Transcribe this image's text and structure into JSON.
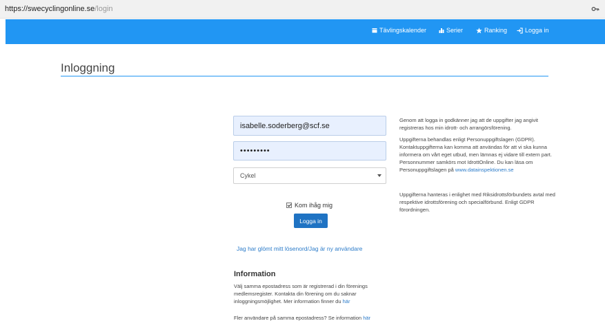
{
  "browser": {
    "url_scheme_host": "https://swecyclingonline.se",
    "url_path": "/login",
    "key_icon": "key-icon"
  },
  "nav": {
    "items": [
      {
        "label": "Tävlingskalender",
        "icon": "calendar-icon"
      },
      {
        "label": "Serier",
        "icon": "bar-chart-icon"
      },
      {
        "label": "Ranking",
        "icon": "star-icon"
      },
      {
        "label": "Logga in",
        "icon": "sign-in-icon"
      }
    ],
    "color": "#2196f3"
  },
  "page": {
    "title": "Inloggning"
  },
  "form": {
    "email_value": "isabelle.soderberg@scf.se",
    "password_value": "•••••••••",
    "sport_selected": "Cykel",
    "remember_label": "Kom ihåg mig",
    "remember_checked": true,
    "login_button": "Logga in",
    "forgot_link": "Jag har glömt mitt lösenord/Jag är ny användare"
  },
  "info": {
    "heading": "Information",
    "p1_text": "Välj samma epostadress som är registrerad i din förenings medlemsregister. Kontakta din förening om du saknar inloggningsmöjlighet. Mer information finner du",
    "p1_link": "här",
    "p2_text": "Fler användare på samma epostadress? Se information",
    "p2_link": "här"
  },
  "notice": {
    "p1": "Genom att logga in godkänner jag att de uppgifter jag angivit registreras hos min idrott- och arrangörsförening.",
    "p2_text": "Uppgifterna behandlas enligt Personuppgiftslagen (GDPR). Kontaktuppgifterna kan komma att användas för att vi ska kunna informera om vårt eget utbud, men lämnas ej vidare till extern part. Personnummer samkörs mot IdrottOnline. Du kan läsa om Personuppgiftslagen på",
    "p2_link": "www.datainspektionen.se",
    "p3": "Uppgifterna hanteras i enlighet med Riksidrottsförbundets avtal med respektive idrottsförening och specialförbund. Enligt GDPR förordningen."
  }
}
